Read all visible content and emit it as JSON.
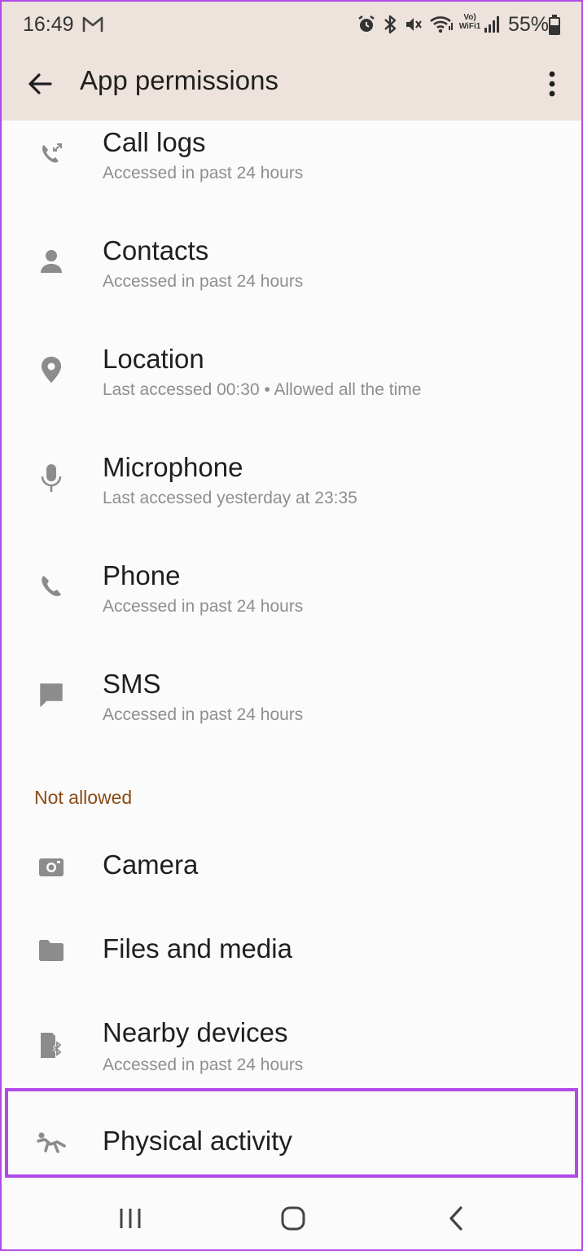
{
  "status_bar": {
    "time": "16:49",
    "battery": "55%",
    "icons": [
      "gmail-icon",
      "alarm-icon",
      "bluetooth-icon",
      "mute-icon",
      "wifi-icon",
      "vowifi-icon",
      "signal-icon",
      "battery-icon"
    ],
    "vowifi_top": "Vo)",
    "vowifi_bottom": "WiFi1"
  },
  "app_bar": {
    "title": "App permissions",
    "back_icon": "arrow-back-icon",
    "more_icon": "more-vert-icon"
  },
  "allowed": [
    {
      "title": "Call logs",
      "subtitle": "Accessed in past 24 hours",
      "icon": "call-log-icon"
    },
    {
      "title": "Contacts",
      "subtitle": "Accessed in past 24 hours",
      "icon": "person-icon"
    },
    {
      "title": "Location",
      "subtitle": "Last accessed 00:30 • Allowed all the time",
      "icon": "location-pin-icon"
    },
    {
      "title": "Microphone",
      "subtitle": "Last accessed yesterday at 23:35",
      "icon": "microphone-icon"
    },
    {
      "title": "Phone",
      "subtitle": "Accessed in past 24 hours",
      "icon": "phone-icon"
    },
    {
      "title": "SMS",
      "subtitle": "Accessed in past 24 hours",
      "icon": "message-icon"
    }
  ],
  "not_allowed_header": "Not allowed",
  "not_allowed": [
    {
      "title": "Camera",
      "icon": "camera-icon"
    },
    {
      "title": "Files and media",
      "icon": "folder-icon"
    },
    {
      "title": "Nearby devices",
      "subtitle": "Accessed in past 24 hours",
      "icon": "nearby-devices-icon"
    },
    {
      "title": "Physical activity",
      "icon": "running-icon"
    }
  ],
  "colors": {
    "header_bg": "#ede2dc",
    "section_header": "#8a4b16",
    "highlight": "#b14ae8",
    "icon": "#8c8c8c"
  },
  "nav_bar": {
    "icons": [
      "recents-icon",
      "home-icon",
      "back-nav-icon"
    ]
  }
}
